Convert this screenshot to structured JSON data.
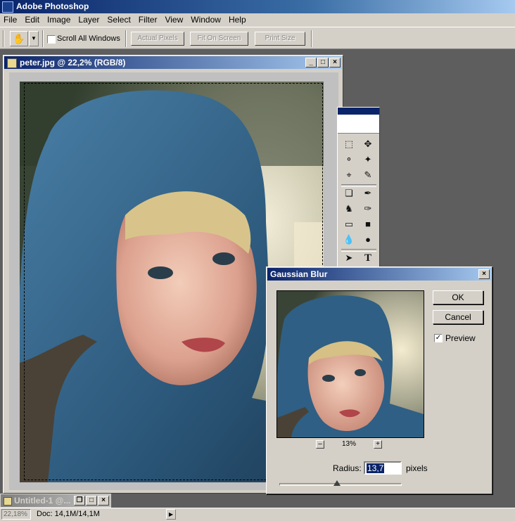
{
  "app": {
    "title": "Adobe Photoshop"
  },
  "menu": [
    "File",
    "Edit",
    "Image",
    "Layer",
    "Select",
    "Filter",
    "View",
    "Window",
    "Help"
  ],
  "options": {
    "scroll_all_windows": "Scroll All Windows",
    "actual_pixels": "Actual Pixels",
    "fit_on_screen": "Fit On Screen",
    "print_size": "Print Size"
  },
  "document": {
    "title": "peter.jpg @ 22,2% (RGB/8)"
  },
  "dialog": {
    "title": "Gaussian Blur",
    "ok": "OK",
    "cancel": "Cancel",
    "preview_label": "Preview",
    "preview_checked": true,
    "zoom": "13%",
    "radius_label": "Radius:",
    "radius_value": "13,7",
    "radius_unit": "pixels",
    "slider_fraction": 0.47
  },
  "minimized": {
    "title": "Untitled-1 @..."
  },
  "status": {
    "zoom": "22,18%",
    "doc": "Doc: 14,1M/14,1M"
  },
  "colors": {
    "title_start": "#0a246a",
    "title_end": "#a6caf0",
    "chrome": "#d4d0c8",
    "workspace": "#5e5e5e"
  },
  "icons": [
    "hand-icon",
    "marquee-icon",
    "move-icon",
    "lasso-icon",
    "magic-wand-icon",
    "crop-icon",
    "slice-icon",
    "healing-brush-icon",
    "brush-icon",
    "clone-stamp-icon",
    "history-brush-icon",
    "eraser-icon",
    "gradient-icon",
    "blur-icon",
    "dodge-icon",
    "path-selection-icon",
    "type-icon"
  ]
}
